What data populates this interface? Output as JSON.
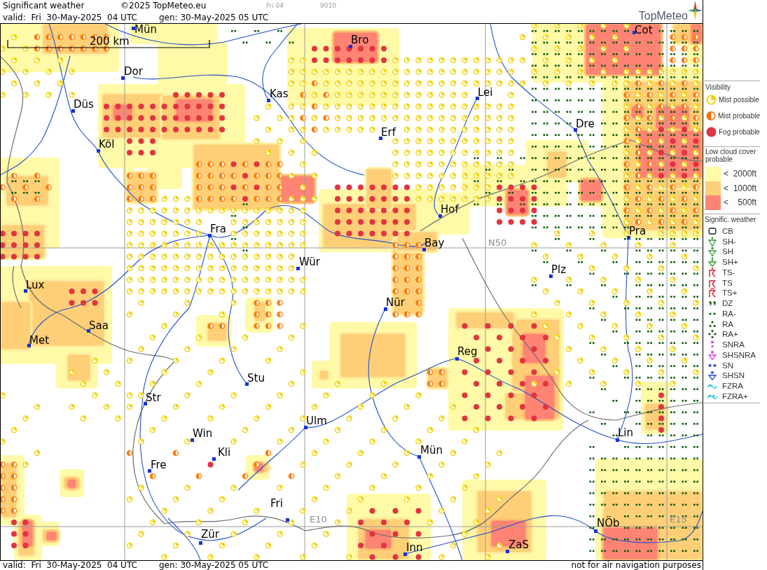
{
  "header": {
    "title": "Significant weather",
    "copyright": "©2025 TopMeteo.eu",
    "frame": "Fri 04",
    "code": "9010",
    "valid": "valid:  Fri  30-May-2025  04 UTC",
    "generated": "gen: 30-May-2025 05 UTC",
    "logo": "TopMeteo"
  },
  "map": {
    "scale_label": "200 km",
    "grid_labels": [
      "N50",
      "E10",
      "E15"
    ],
    "cities": [
      "Mün",
      "Bro",
      "Cot",
      "Dor",
      "Kas",
      "Lei",
      "Düs",
      "Dre",
      "Erf",
      "Köl",
      "Hof",
      "Pra",
      "Fra",
      "Bay",
      "Wür",
      "Plz",
      "Lux",
      "Nür",
      "Saa",
      "Met",
      "Reg",
      "Stu",
      "Str",
      "Ulm",
      "Win",
      "Lin",
      "Kli",
      "Mün",
      "Fre",
      "Fri",
      "NÖb",
      "Zür",
      "ZaS",
      "Inn"
    ]
  },
  "legend": {
    "visibility": {
      "title": "Visibility",
      "items": [
        "Mist possible",
        "Mist probable",
        "Fog probable"
      ]
    },
    "low_cloud": {
      "title": "Low cloud cover probable",
      "items": [
        {
          "sign": "<",
          "value": "2000ft",
          "color": "#fffaa8"
        },
        {
          "sign": "<",
          "value": "1000ft",
          "color": "#ffcf78"
        },
        {
          "sign": "<",
          "value": "500ft",
          "color": "#ff8474"
        }
      ]
    },
    "significant_weather": {
      "title": "Signific. weather",
      "items": [
        "CB",
        "SH-",
        "SH",
        "SH+",
        "TS-",
        "TS",
        "TS+",
        "DZ",
        "RA-",
        "RA",
        "RA+",
        "SNRA",
        "SHSNRA",
        "SN",
        "SHSN",
        "FZRA",
        "FZRA+"
      ]
    }
  },
  "footer": {
    "valid": "valid:  Fri  30-May-2025  04 UTC",
    "generated": "gen: 30-May-2025 05 UTC",
    "note": "not for air navigation purposes"
  }
}
